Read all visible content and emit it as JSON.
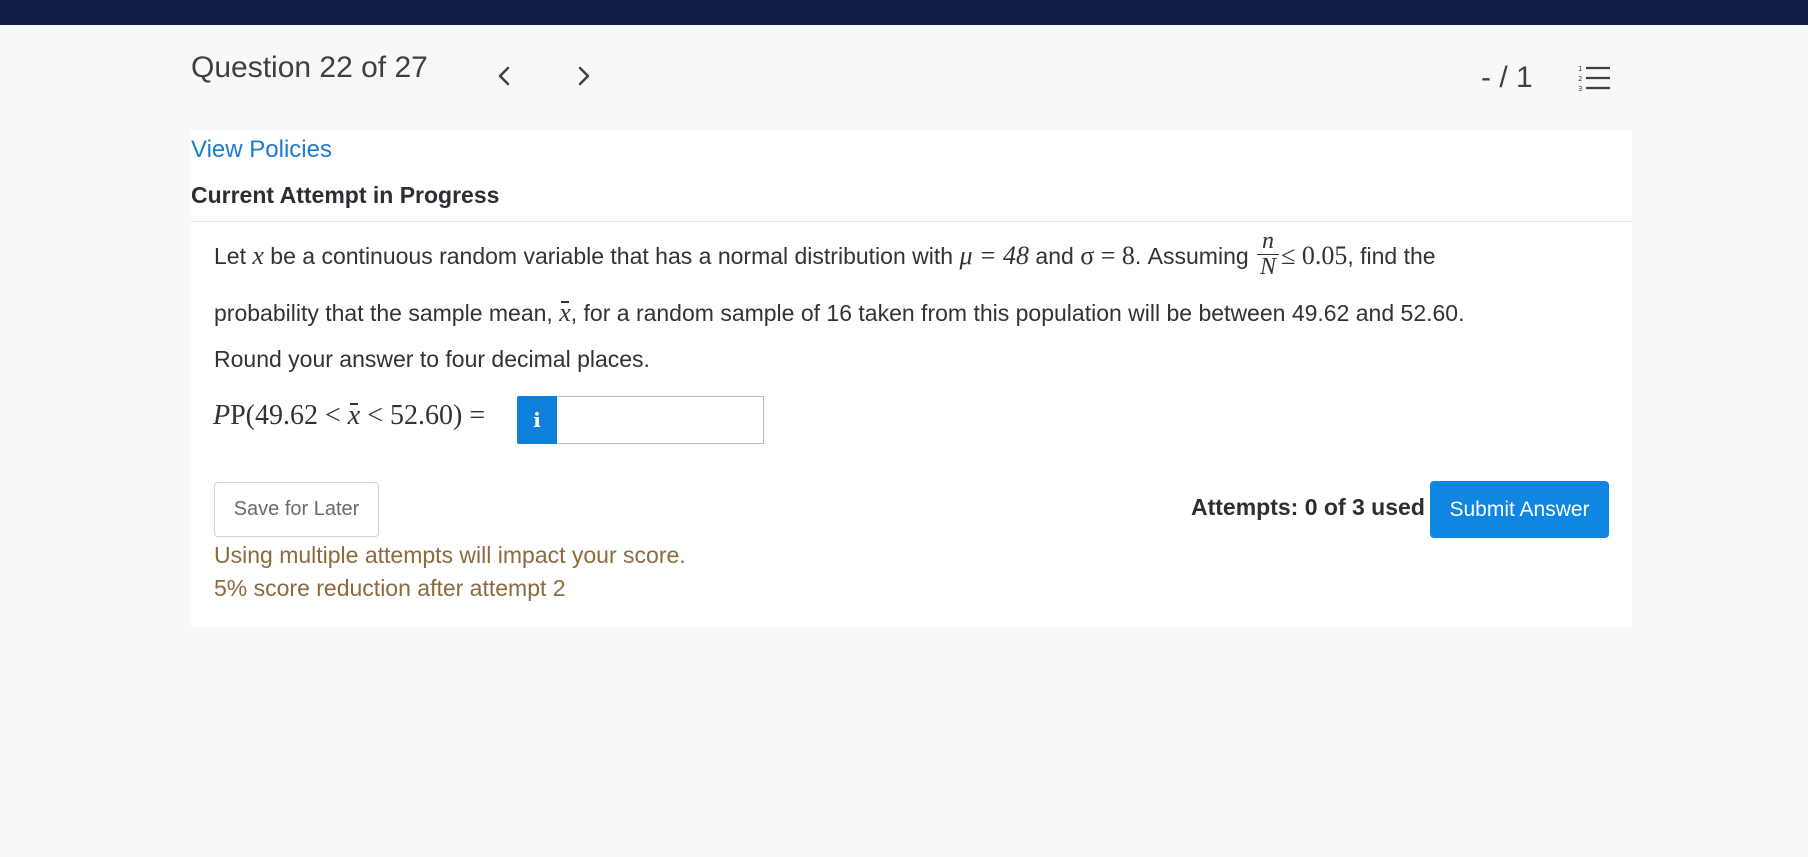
{
  "header": {
    "question_title": "Question 22 of 27",
    "score": "- / 1",
    "prev_icon": "chevron-left-icon",
    "next_icon": "chevron-right-icon",
    "list_icon": "numbered-list-icon"
  },
  "links": {
    "view_policies": "View Policies"
  },
  "attempt": {
    "heading": "Current Attempt in Progress"
  },
  "question": {
    "text_let": "Let ",
    "var_x": "x",
    "text_normal": " be a continuous random variable that has a normal distribution with ",
    "mu_eq": "μ = 48",
    "text_and": " and ",
    "sigma_eq": "σ = 8",
    "text_assuming": ". Assuming ",
    "frac_num": "n",
    "frac_den": "N",
    "le_value": "≤ 0.05",
    "text_find": ", find the",
    "text_prob_start": "probability that the sample mean, ",
    "xbar_symbol": "x",
    "text_prob_end": ", for a random sample of 16 taken from this population will be between 49.62 and 52.60.",
    "text_round": "Round your answer to four decimal places.",
    "prob_prefix": "P(49.62 < ",
    "prob_xbar": "x",
    "prob_suffix": " < 52.60)  =",
    "info_label": "i",
    "answer_value": ""
  },
  "actions": {
    "save_label": "Save for Later",
    "attempts_text": "Attempts: 0 of 3 used",
    "submit_label": "Submit Answer"
  },
  "warnings": {
    "line1": "Using multiple attempts will impact your score.",
    "line2": "5% score reduction after attempt 2"
  },
  "colors": {
    "topbar": "#131e46",
    "link": "#1b7bd0",
    "primary": "#0f86e2",
    "warning": "#8c6a3e"
  }
}
